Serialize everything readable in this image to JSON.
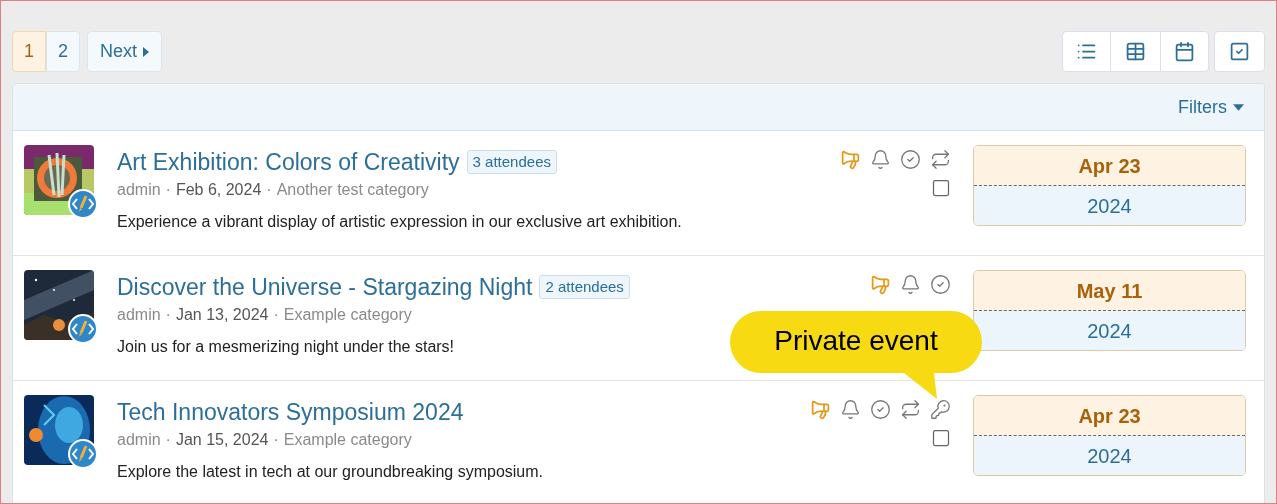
{
  "pagination": {
    "pages": [
      {
        "label": "1",
        "selected": true
      },
      {
        "label": "2",
        "selected": false
      }
    ],
    "next": "Next"
  },
  "filters": {
    "label": "Filters"
  },
  "events": [
    {
      "title": "Art Exhibition: Colors of Creativity",
      "attendees": "3 attendees",
      "meta": [
        {
          "kind": "author",
          "text": "admin"
        },
        {
          "kind": "separator",
          "text": "·"
        },
        {
          "kind": "date",
          "text": "Feb 6, 2024"
        },
        {
          "kind": "separator",
          "text": "·"
        },
        {
          "kind": "category",
          "text": "Another test category"
        }
      ],
      "description": "Experience a vibrant display of artistic expression in our exclusive art exhibition.",
      "icons": [
        {
          "kind": "megaphone"
        },
        {
          "kind": "bell"
        },
        {
          "kind": "check"
        },
        {
          "kind": "repeat"
        }
      ],
      "checkbox": {
        "checked": false
      },
      "month_day": "Apr 23",
      "year": "2024"
    },
    {
      "title": "Discover the Universe - Stargazing Night",
      "attendees": "2 attendees",
      "meta": [
        {
          "kind": "author",
          "text": "admin"
        },
        {
          "kind": "separator",
          "text": "·"
        },
        {
          "kind": "date",
          "text": "Jan 13, 2024"
        },
        {
          "kind": "separator",
          "text": "·"
        },
        {
          "kind": "category",
          "text": "Example category"
        }
      ],
      "description": "Join us for a mesmerizing night under the stars!",
      "icons": [
        {
          "kind": "megaphone"
        },
        {
          "kind": "bell"
        },
        {
          "kind": "check"
        }
      ],
      "month_day": "May 11",
      "year": "2024"
    },
    {
      "title": "Tech Innovators Symposium 2024",
      "meta": [
        {
          "kind": "author",
          "text": "admin"
        },
        {
          "kind": "separator",
          "text": "·"
        },
        {
          "kind": "date",
          "text": "Jan 15, 2024"
        },
        {
          "kind": "separator",
          "text": "·"
        },
        {
          "kind": "category",
          "text": "Example category"
        }
      ],
      "description": "Explore the latest in tech at our groundbreaking symposium.",
      "icons": [
        {
          "kind": "megaphone"
        },
        {
          "kind": "bell"
        },
        {
          "kind": "check"
        },
        {
          "kind": "repeat"
        },
        {
          "kind": "key"
        }
      ],
      "checkbox": {
        "checked": false
      },
      "month_day": "Apr 23",
      "year": "2024"
    }
  ],
  "callout": {
    "text": "Private event"
  }
}
